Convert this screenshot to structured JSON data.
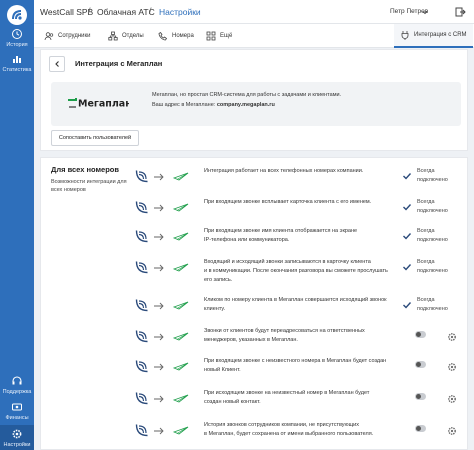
{
  "sidebar": {
    "items": [
      {
        "label": "История",
        "icon": "history-icon"
      },
      {
        "label": "Статистика",
        "icon": "bar-chart-icon"
      },
      {
        "label": "Поддержка",
        "icon": "support-icon"
      },
      {
        "label": "Финансы",
        "icon": "finance-icon"
      },
      {
        "label": "Настройки",
        "icon": "settings-icon"
      }
    ]
  },
  "topbar": {
    "brand": "WestCall SPB",
    "section": "Облачная АТС",
    "current": "Настройки",
    "user": "Петр Петров"
  },
  "tabs": [
    {
      "label": "Сотрудники"
    },
    {
      "label": "Отделы"
    },
    {
      "label": "Номера"
    },
    {
      "label": "Ещё"
    },
    {
      "label": "Интеграция с CRM"
    }
  ],
  "page": {
    "title": "Интеграция с Мегаплан",
    "logo_text": "Мегаплан",
    "description": "Мегаплан, но простая CRM-система для работы с задачами и клиентами.",
    "address_label": "Ваш адрес в Мегаплане:",
    "address_value": "company.megaplan.ru",
    "sync_button": "Сопоставить пользователей"
  },
  "section": {
    "title": "Для всех номеров",
    "subtitle": "Возможности интеграции для всех номеров"
  },
  "rows": [
    {
      "line1": "Интеграция работает на всех телефонных номерах компании.",
      "line2": "",
      "line3": "",
      "state_line1": "Всегда",
      "state_line2": "подключено"
    },
    {
      "line1": "При входящем звонке всплывает карточка клиента с его именем.",
      "line2": "",
      "line3": "",
      "state_line1": "Всегда",
      "state_line2": "подключено"
    },
    {
      "line1": "При входящем звонке имя клиента отображается на экране",
      "line2": "IP-телефона или коммуникатора.",
      "line3": "",
      "state_line1": "Всегда",
      "state_line2": "подключено"
    },
    {
      "line1": "Входящий и исходящий звонки записываются в карточку клиента",
      "line2": "и в коммуникации. После окончания разговора вы сможете прослушать",
      "line3": "его запись.",
      "state_line1": "Всегда",
      "state_line2": "подключено"
    },
    {
      "line1": "Кликом по номеру клиента в Мегаплан совершается исходящий звонок",
      "line2": "клиенту.",
      "line3": "",
      "state_line1": "Всегда",
      "state_line2": "подключено"
    },
    {
      "line1": "Звонки от клиентов будут переадресоваться на ответственных",
      "line2": "менеджеров, указанных в Мегаплан.",
      "line3": ""
    },
    {
      "line1": "При входящем звонке с неизвестного номера в Мегаплан будет создан",
      "line2": "новый Клиент.",
      "line3": ""
    },
    {
      "line1": "При исходящем звонке на неизвестный номер в Мегаплан будет",
      "line2": "создан новый контакт.",
      "line3": ""
    },
    {
      "line1": "История звонков сотрудников компании, не присутствующих",
      "line2": "в Мегаплан, будет сохранена от имени выбранного пользователя.",
      "line3": ""
    }
  ],
  "colors": {
    "primary": "#2e6fbb",
    "sidebar": "#2e6fbb",
    "check": "#2a4a7a"
  }
}
